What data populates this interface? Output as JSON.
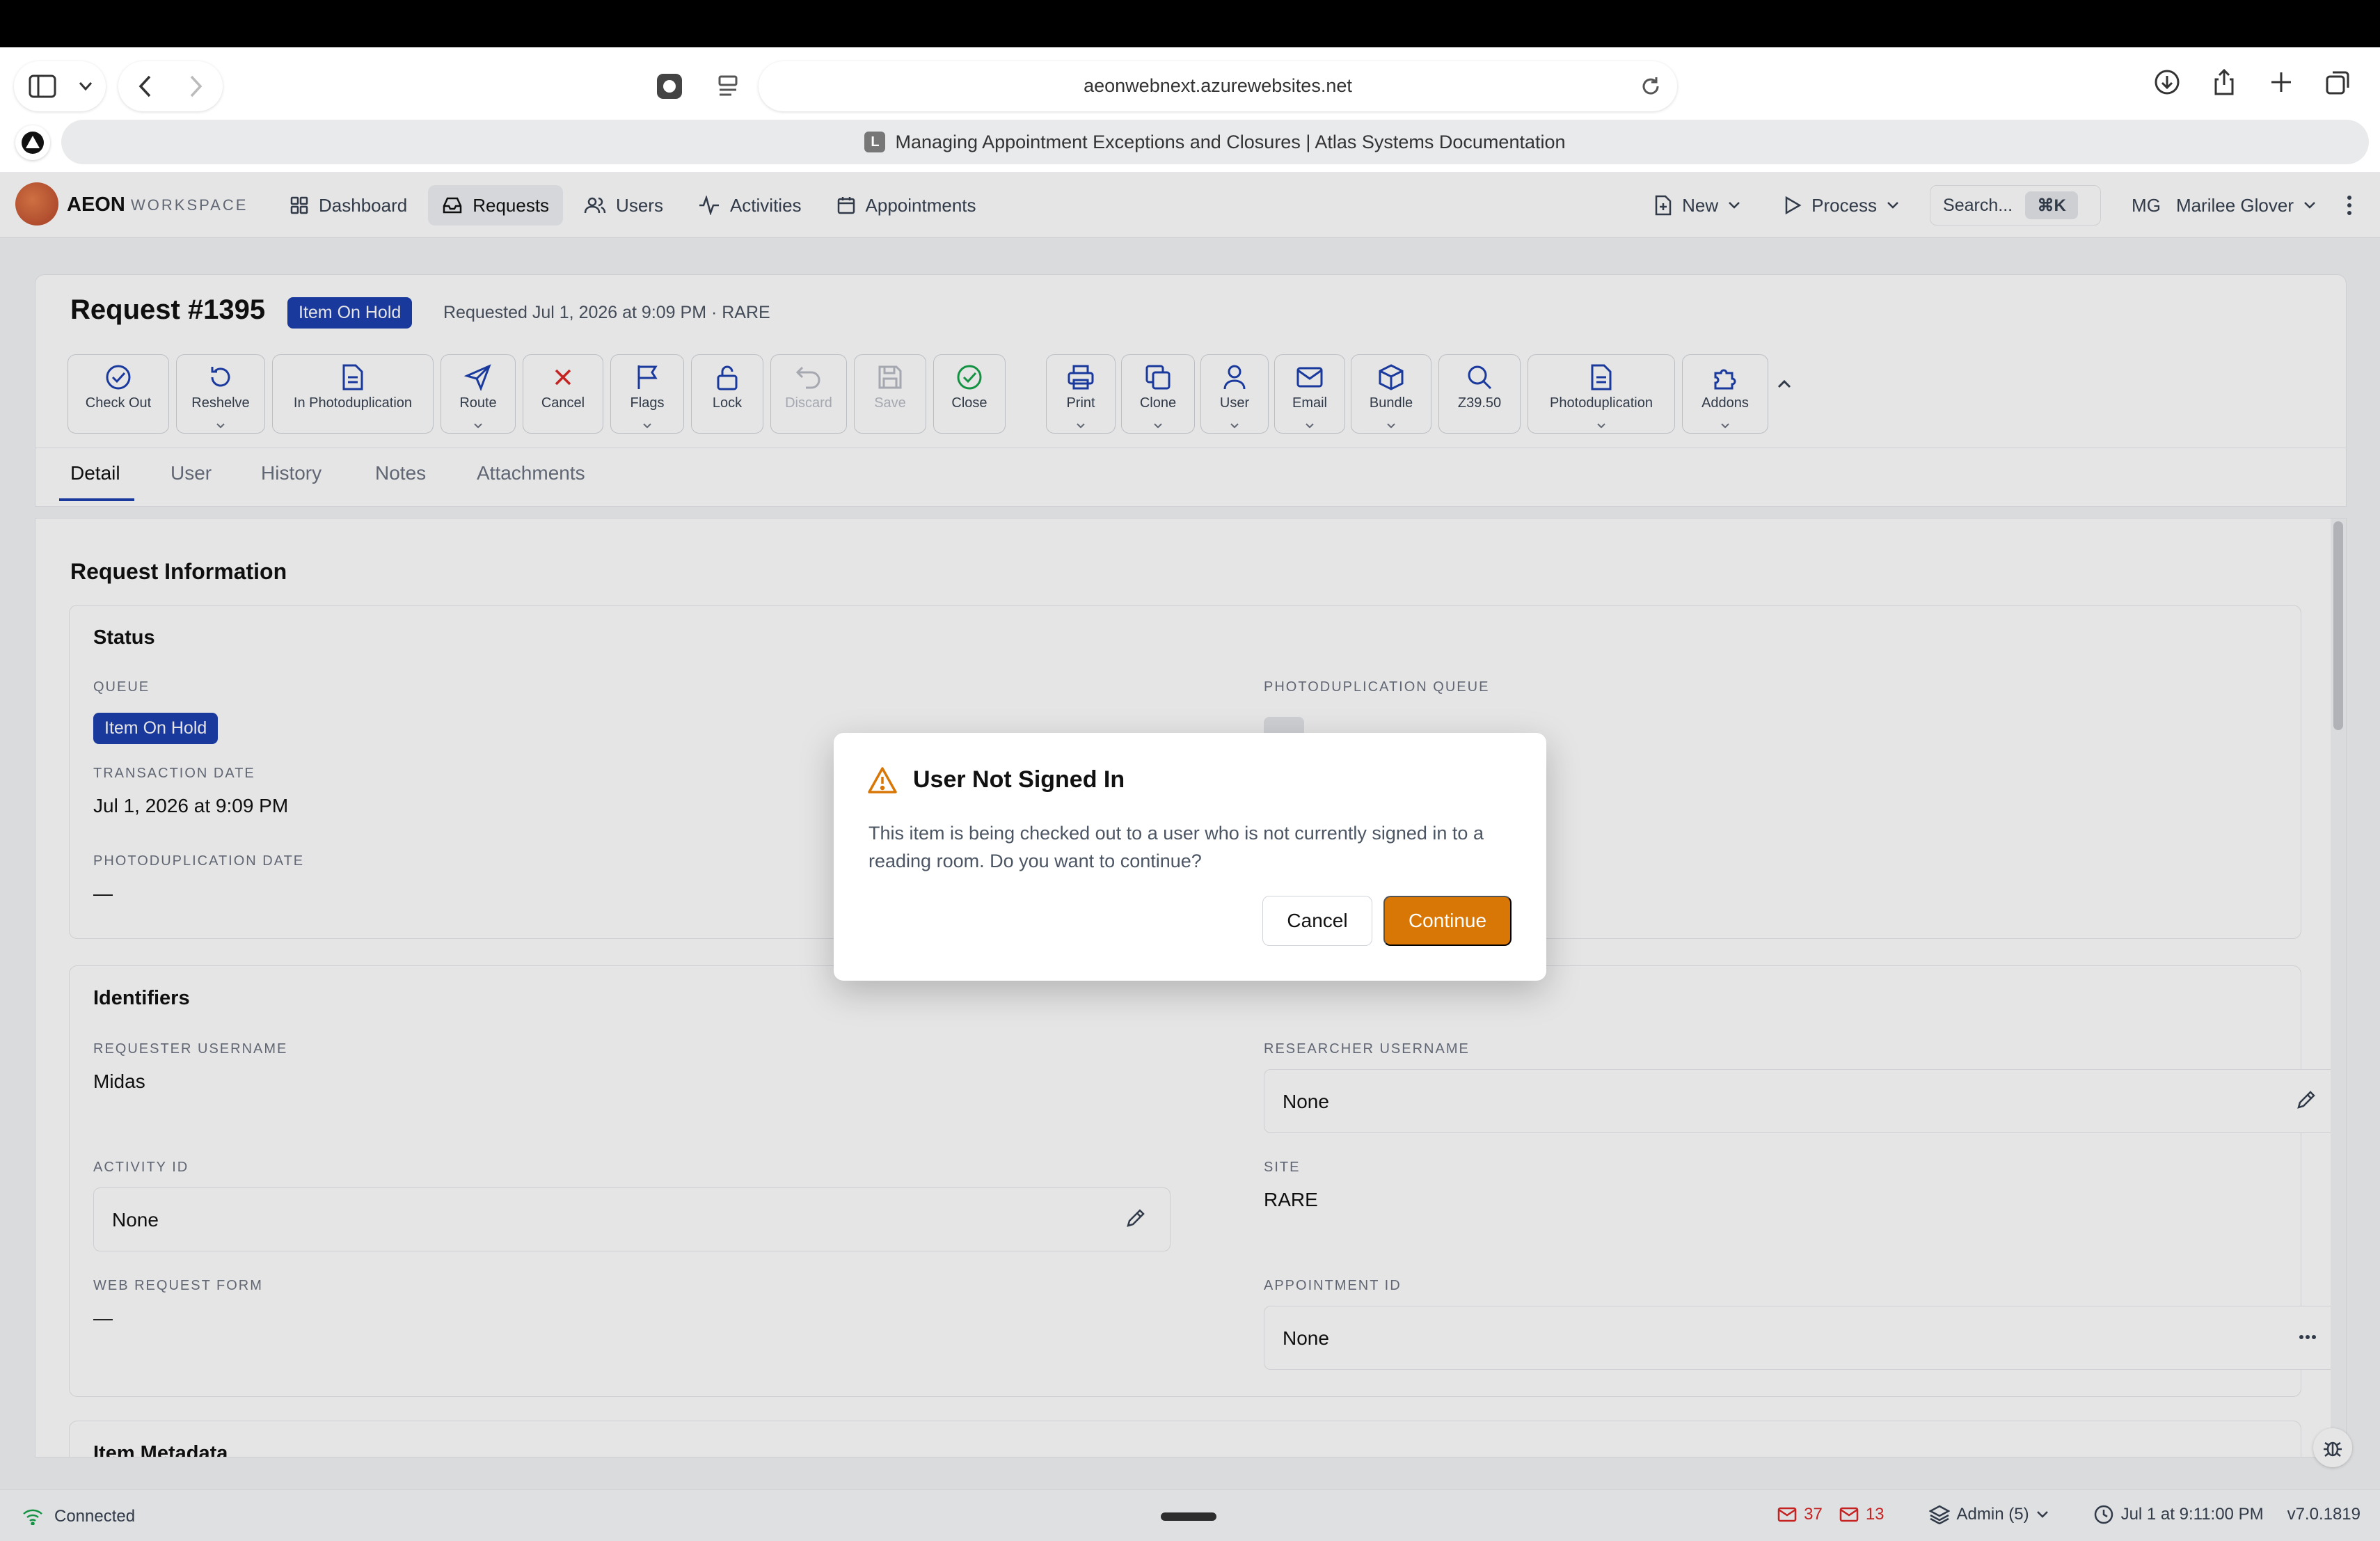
{
  "browser": {
    "url": "aeonwebnext.azurewebsites.net",
    "tab_title": "Managing Appointment Exceptions and Closures | Atlas Systems Documentation",
    "tab_favicon_letter": "L"
  },
  "app": {
    "brand": "AEON",
    "brand_sub": "WORKSPACE",
    "nav": [
      {
        "label": "Dashboard",
        "icon": "dashboard-icon"
      },
      {
        "label": "Requests",
        "icon": "inbox-icon",
        "active": true
      },
      {
        "label": "Users",
        "icon": "users-icon"
      },
      {
        "label": "Activities",
        "icon": "activity-icon"
      },
      {
        "label": "Appointments",
        "icon": "calendar-icon"
      }
    ],
    "new_label": "New",
    "process_label": "Process",
    "search_placeholder": "Search...",
    "search_shortcut": "⌘K",
    "user_initials": "MG",
    "user_name": "Marilee Glover"
  },
  "request": {
    "title": "Request #1395",
    "status_badge": "Item On Hold",
    "meta": "Requested Jul 1, 2026 at 9:09 PM  ·  RARE"
  },
  "toolbar": [
    {
      "label": "Check Out",
      "icon": "check-circle-icon"
    },
    {
      "label": "Reshelve",
      "icon": "rotate-icon",
      "dropdown": true
    },
    {
      "label": "In Photoduplication",
      "icon": "document-icon"
    },
    {
      "label": "Route",
      "icon": "send-icon",
      "dropdown": true
    },
    {
      "label": "Cancel",
      "icon": "x-icon"
    },
    {
      "label": "Flags",
      "icon": "flag-icon",
      "dropdown": true
    },
    {
      "label": "Lock",
      "icon": "lock-icon"
    },
    {
      "label": "Discard",
      "icon": "undo-icon",
      "disabled": true
    },
    {
      "label": "Save",
      "icon": "save-icon",
      "disabled": true
    },
    {
      "label": "Close",
      "icon": "check-circle-icon"
    },
    {
      "label": "Print",
      "icon": "printer-icon",
      "dropdown": true
    },
    {
      "label": "Clone",
      "icon": "copy-icon",
      "dropdown": true
    },
    {
      "label": "User",
      "icon": "user-icon",
      "dropdown": true
    },
    {
      "label": "Email",
      "icon": "mail-icon",
      "dropdown": true
    },
    {
      "label": "Bundle",
      "icon": "box-icon",
      "dropdown": true
    },
    {
      "label": "Z39.50",
      "icon": "search-icon"
    },
    {
      "label": "Photoduplication",
      "icon": "document-icon",
      "dropdown": true
    },
    {
      "label": "Addons",
      "icon": "puzzle-icon",
      "dropdown": true
    }
  ],
  "tabs": [
    "Detail",
    "User",
    "History",
    "Notes",
    "Attachments"
  ],
  "content": {
    "section_title": "Request Information",
    "status": {
      "title": "Status",
      "queue_label": "QUEUE",
      "queue_value": "Item On Hold",
      "transaction_date_label": "TRANSACTION DATE",
      "transaction_date_value": "Jul 1, 2026 at 9:09 PM",
      "photodup_date_label": "PHOTODUPLICATION DATE",
      "photodup_date_value": "—",
      "photodup_queue_label": "PHOTODUPLICATION QUEUE"
    },
    "identifiers": {
      "title": "Identifiers",
      "requester_username_label": "REQUESTER USERNAME",
      "requester_username_value": "Midas",
      "researcher_username_label": "RESEARCHER USERNAME",
      "researcher_username_value": "None",
      "activity_id_label": "ACTIVITY ID",
      "activity_id_value": "None",
      "site_label": "SITE",
      "site_value": "RARE",
      "web_request_form_label": "WEB REQUEST FORM",
      "web_request_form_value": "—",
      "appointment_id_label": "APPOINTMENT ID",
      "appointment_id_value": "None"
    },
    "next_section_title": "Item Metadata"
  },
  "statusbar": {
    "connection": "Connected",
    "count_a": "37",
    "count_b": "13",
    "role": "Admin  (5)",
    "datetime": "Jul 1 at 9:11:00 PM",
    "version": "v7.0.1819"
  },
  "modal": {
    "title": "User Not Signed In",
    "body": "This item is being checked out to a user who is not currently signed in to a reading room. Do you want to continue?",
    "cancel_label": "Cancel",
    "continue_label": "Continue"
  },
  "colors": {
    "accent": "#1e40af",
    "warning": "#d97706",
    "danger": "#dc2626",
    "success": "#16a34a"
  }
}
